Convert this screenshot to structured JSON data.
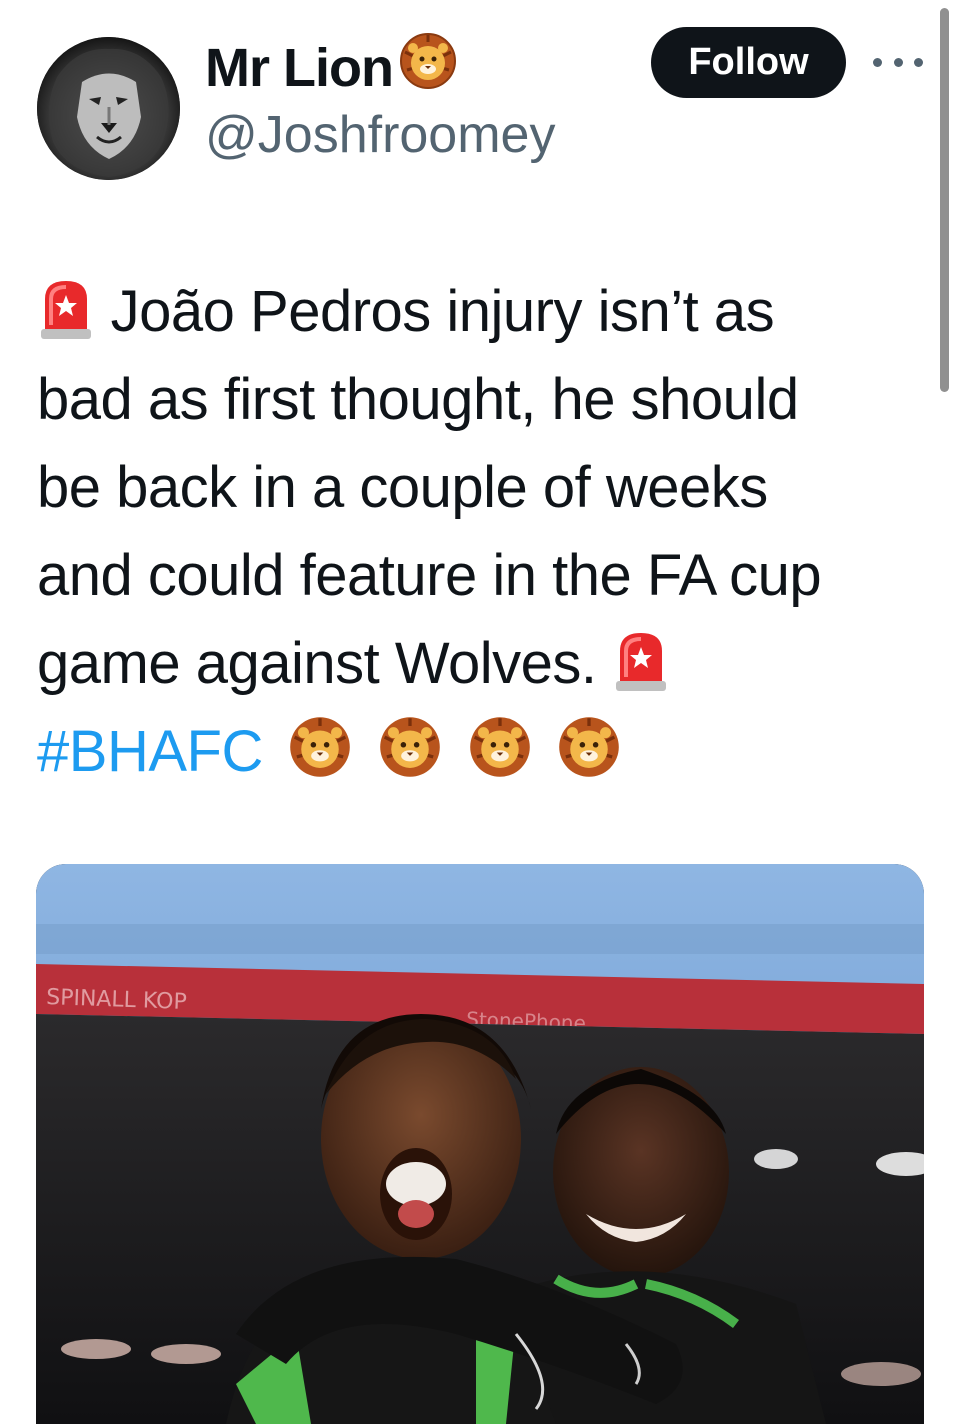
{
  "author": {
    "display_name": "Mr Lion",
    "name_emoji": "lion-face-emoji",
    "handle": "@Joshfroomey",
    "avatar": "lion-portrait-avatar"
  },
  "actions": {
    "follow_label": "Follow",
    "more_icon": "more-options-icon"
  },
  "tweet": {
    "lines": [
      "João Pedros injury isn’t as",
      "bad as first thought, he should",
      "be back in a couple of weeks",
      "and could feature in the FA cup",
      "game against Wolves."
    ],
    "hashtag": "#BHAFC",
    "hashtag_emoji_count": 4,
    "siren_emoji": "police-siren-emoji"
  },
  "media": {
    "type": "photo",
    "stand_banner_text": "SPINALL KOP",
    "sponsor_text": "StonePhone"
  },
  "colors": {
    "text": "#0f1419",
    "secondary": "#536471",
    "link": "#1d9bf0",
    "button_bg": "#0f1419",
    "button_text": "#ffffff"
  }
}
